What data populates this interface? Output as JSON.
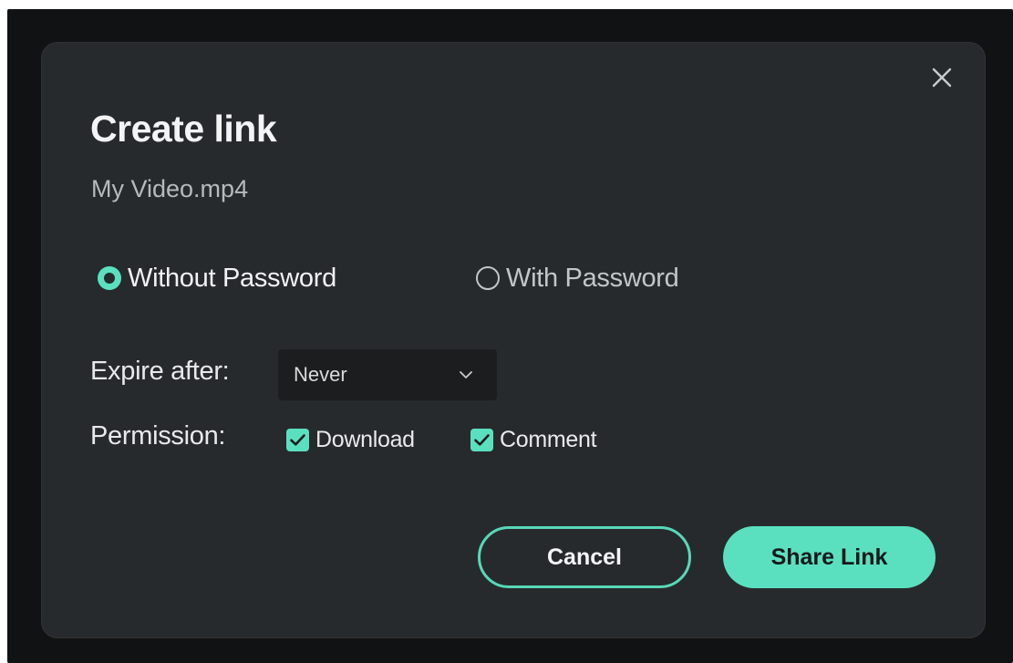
{
  "dialog": {
    "title": "Create link",
    "filename": "My Video.mp4",
    "close_icon": "close-icon"
  },
  "password": {
    "options": [
      {
        "label": "Without Password",
        "selected": true
      },
      {
        "label": "With Password",
        "selected": false
      }
    ]
  },
  "expire": {
    "label": "Expire after:",
    "value": "Never",
    "icon": "chevron-down-icon"
  },
  "permission": {
    "label": "Permission:",
    "options": [
      {
        "label": "Download",
        "checked": true
      },
      {
        "label": "Comment",
        "checked": true
      }
    ]
  },
  "actions": {
    "cancel_label": "Cancel",
    "share_label": "Share Link"
  },
  "colors": {
    "accent": "#5be0bf",
    "dialog_bg": "#272a2d",
    "backdrop": "#111213"
  }
}
